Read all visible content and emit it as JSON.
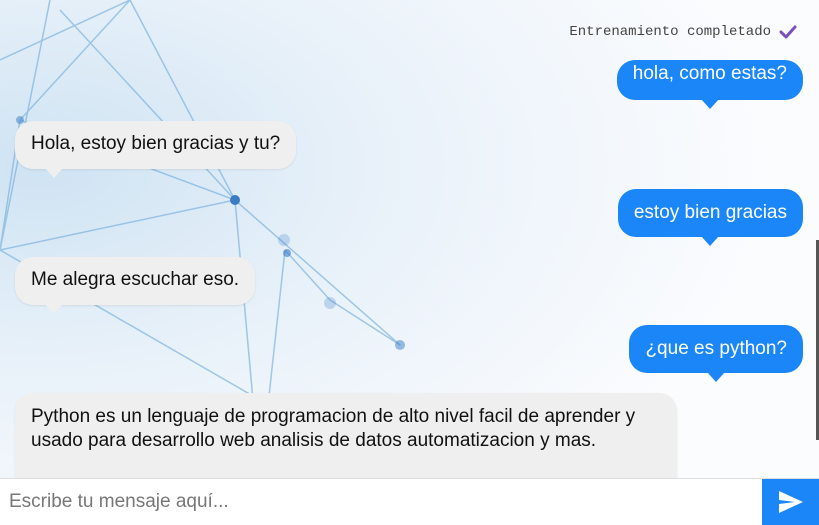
{
  "status": {
    "text": "Entrenamiento completado",
    "icon": "checkmark-icon",
    "icon_color": "#7a4fc2"
  },
  "messages": [
    {
      "sender": "user",
      "text": "hola, como estas?"
    },
    {
      "sender": "bot",
      "text": "Hola, estoy bien gracias y tu?"
    },
    {
      "sender": "user",
      "text": "estoy bien gracias"
    },
    {
      "sender": "bot",
      "text": "Me alegra escuchar eso."
    },
    {
      "sender": "user",
      "text": "¿que es python?"
    },
    {
      "sender": "bot",
      "text": "Python es un lenguaje de programacion de alto nivel facil de aprender y usado para desarrollo web analisis de datos automatizacion y mas."
    }
  ],
  "composer": {
    "placeholder": "Escribe tu mensaje aquí...",
    "value": "",
    "send_icon": "send-icon"
  },
  "colors": {
    "user_bubble": "#1a86f8",
    "bot_bubble": "#efefef",
    "send_button": "#1a86f8"
  }
}
